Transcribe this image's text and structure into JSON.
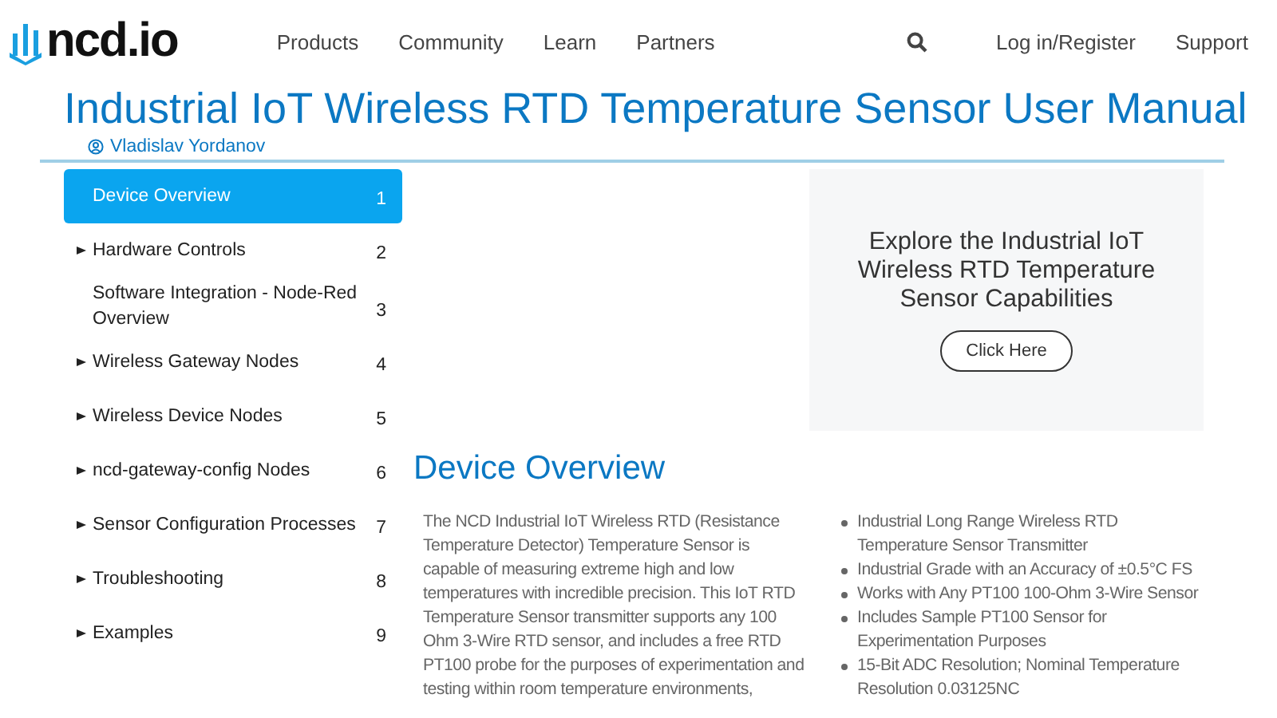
{
  "header": {
    "logo": "ncd.io",
    "nav": [
      "Products",
      "Community",
      "Learn",
      "Partners"
    ],
    "right_links": [
      "Log in/Register",
      "Support"
    ]
  },
  "title": "Industrial IoT Wireless RTD Temperature Sensor User Manual",
  "author": "Vladislav Yordanov",
  "sidebar": {
    "items": [
      {
        "label": "Device Overview",
        "number": "1",
        "expandable": false,
        "selected": true
      },
      {
        "label": "Hardware Controls",
        "number": "2",
        "expandable": true,
        "selected": false
      },
      {
        "label": "Software Integration - Node-Red Overview",
        "number": "3",
        "expandable": false,
        "selected": false
      },
      {
        "label": "Wireless Gateway Nodes",
        "number": "4",
        "expandable": true,
        "selected": false
      },
      {
        "label": "Wireless Device Nodes",
        "number": "5",
        "expandable": true,
        "selected": false
      },
      {
        "label": "ncd-gateway-config Nodes",
        "number": "6",
        "expandable": true,
        "selected": false
      },
      {
        "label": "Sensor Configuration Processes",
        "number": "7",
        "expandable": true,
        "selected": false
      },
      {
        "label": "Troubleshooting",
        "number": "8",
        "expandable": true,
        "selected": false
      },
      {
        "label": "Examples",
        "number": "9",
        "expandable": true,
        "selected": false
      }
    ]
  },
  "promo": {
    "text": "Explore the Industrial IoT Wireless RTD Temperature Sensor Capabilities",
    "button": "Click Here"
  },
  "section": {
    "heading": "Device Overview",
    "paragraph": "The NCD Industrial IoT Wireless RTD (Resistance Temperature Detector) Temperature Sensor is capable of measuring extreme high and low temperatures with incredible precision.  This IoT RTD Temperature Sensor transmitter supports any 100 Ohm 3-Wire RTD sensor, and includes a free RTD PT100 probe for the purposes of experimentation and testing within room temperature environments,",
    "bullets": [
      "Industrial Long Range Wireless RTD Temperature Sensor Transmitter",
      "Industrial Grade with an Accuracy of ±0.5°C FS",
      "Works with Any PT100 100-Ohm 3-Wire Sensor",
      "Includes Sample PT100 Sensor for Experimentation Purposes",
      "15-Bit ADC Resolution; Nominal Temperature Resolution 0.03125NC"
    ]
  }
}
